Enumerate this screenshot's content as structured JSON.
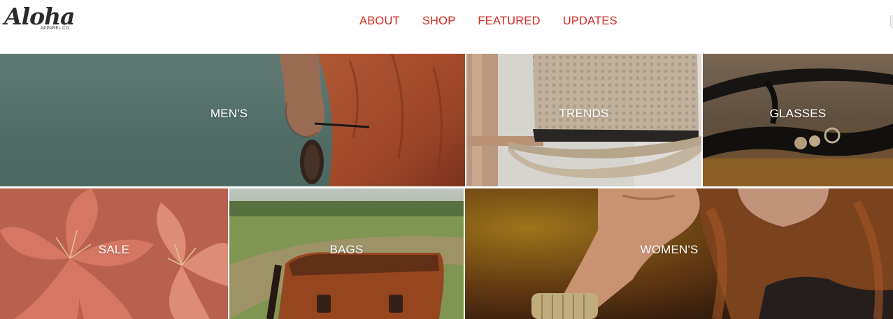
{
  "brand": {
    "name": "Aloha",
    "tagline": "APPAREL CO."
  },
  "nav": {
    "items": [
      {
        "label": "ABOUT"
      },
      {
        "label": "SHOP"
      },
      {
        "label": "FEATURED"
      },
      {
        "label": "UPDATES"
      }
    ]
  },
  "tiles": {
    "mens": {
      "label": "MEN'S"
    },
    "trends": {
      "label": "TRENDS"
    },
    "glasses": {
      "label": "GLASSES"
    },
    "sale": {
      "label": "SALE"
    },
    "bags": {
      "label": "BAGS"
    },
    "womens": {
      "label": "WOMEN'S"
    }
  },
  "colors": {
    "nav_text": "#d42a22",
    "tile_label": "#ffffff",
    "logo": "#2b2b2b"
  }
}
